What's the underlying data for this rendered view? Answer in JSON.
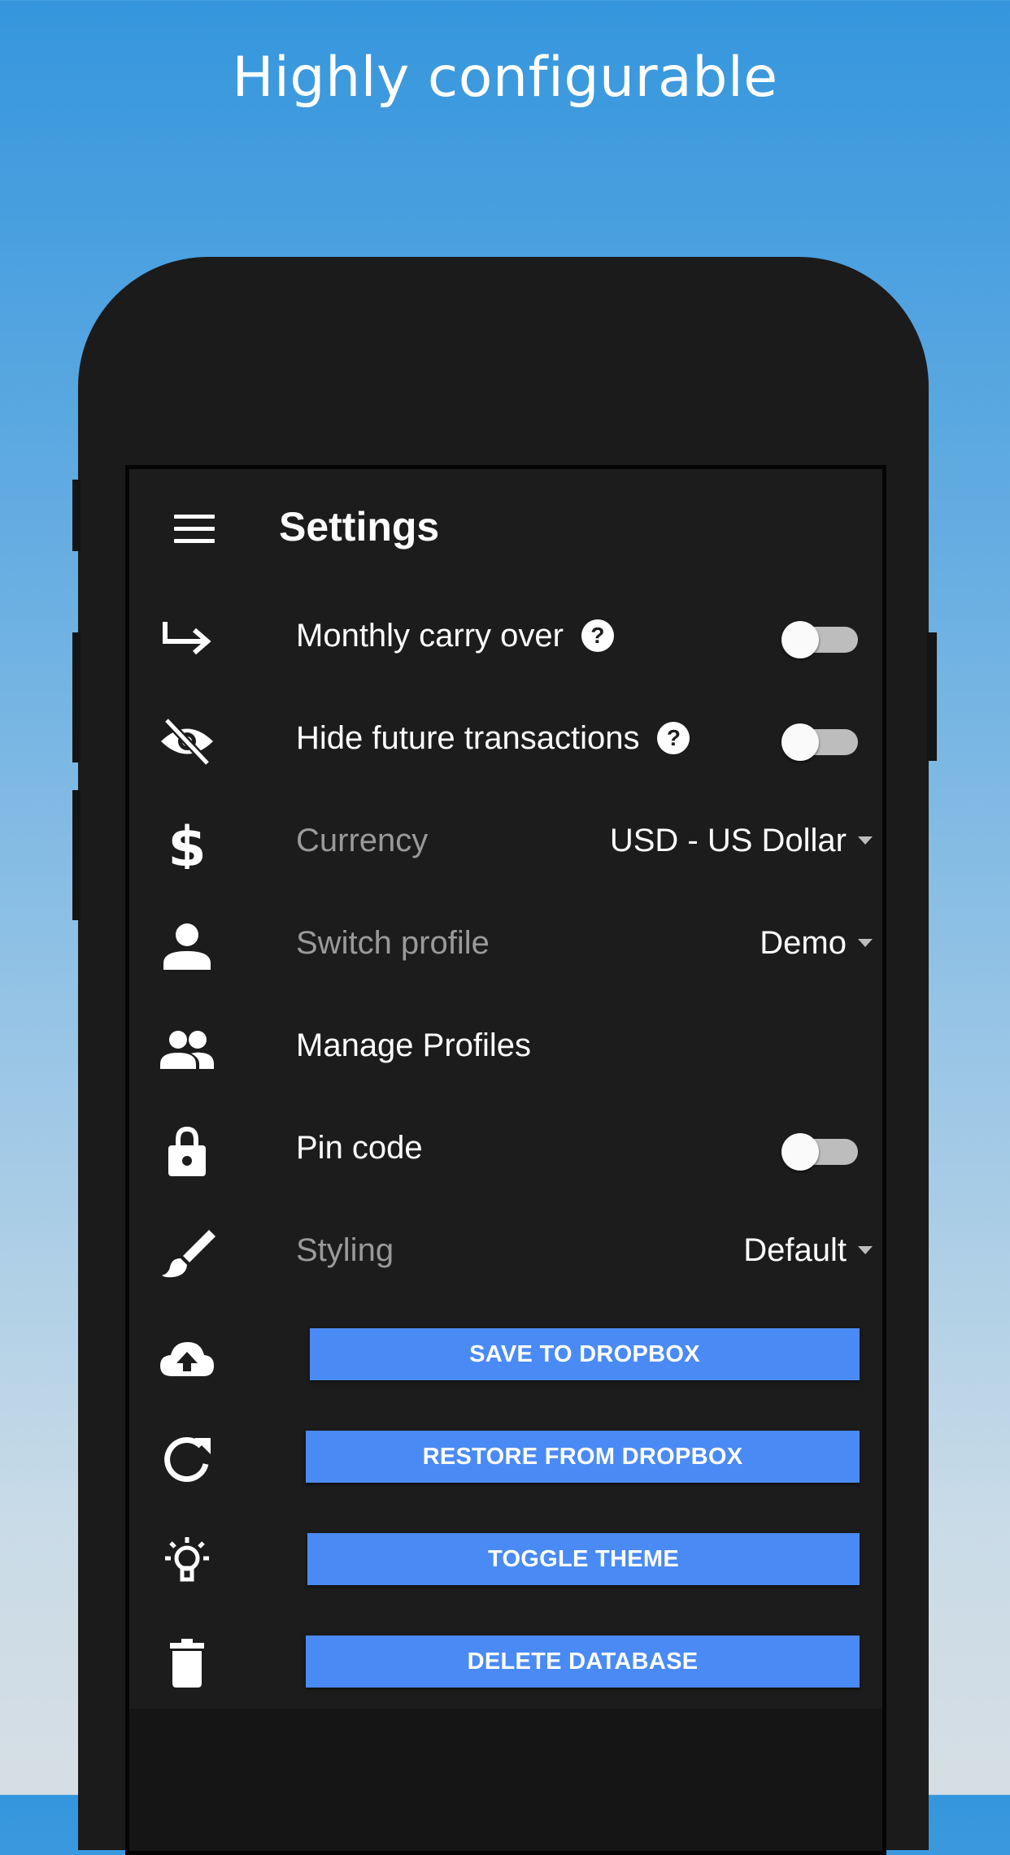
{
  "headline": "Highly configurable",
  "app_bar": {
    "title": "Settings",
    "menu_icon": "hamburger-menu-icon"
  },
  "settings": {
    "monthly_carry_over": {
      "label": "Monthly carry over",
      "help": "?",
      "icon": "arrow-turn-right-icon",
      "enabled": false
    },
    "hide_future_transactions": {
      "label": "Hide future transactions",
      "help": "?",
      "icon": "eye-off-icon",
      "enabled": false
    },
    "currency": {
      "label": "Currency",
      "value": "USD - US Dollar",
      "icon": "dollar-icon"
    },
    "switch_profile": {
      "label": "Switch profile",
      "value": "Demo",
      "icon": "person-icon"
    },
    "manage_profiles": {
      "label": "Manage Profiles",
      "icon": "people-icon"
    },
    "pin_code": {
      "label": "Pin code",
      "icon": "lock-icon",
      "enabled": false
    },
    "styling": {
      "label": "Styling",
      "value": "Default",
      "icon": "brush-icon"
    }
  },
  "actions": {
    "save_to_dropbox": {
      "label": "SAVE TO DROPBOX",
      "icon": "cloud-upload-icon"
    },
    "restore_from_dropbox": {
      "label": "RESTORE FROM DROPBOX",
      "icon": "refresh-icon"
    },
    "toggle_theme": {
      "label": "TOGGLE THEME",
      "icon": "lightbulb-icon"
    },
    "delete_database": {
      "label": "DELETE DATABASE",
      "icon": "trash-icon"
    }
  },
  "colors": {
    "background_top": "#3596dd",
    "background_bottom": "#d6dee5",
    "phone_body": "#1b1b1c",
    "screen": "#1c1c1c",
    "button": "#4a8af4",
    "dim_label": "#9a9a9a"
  }
}
